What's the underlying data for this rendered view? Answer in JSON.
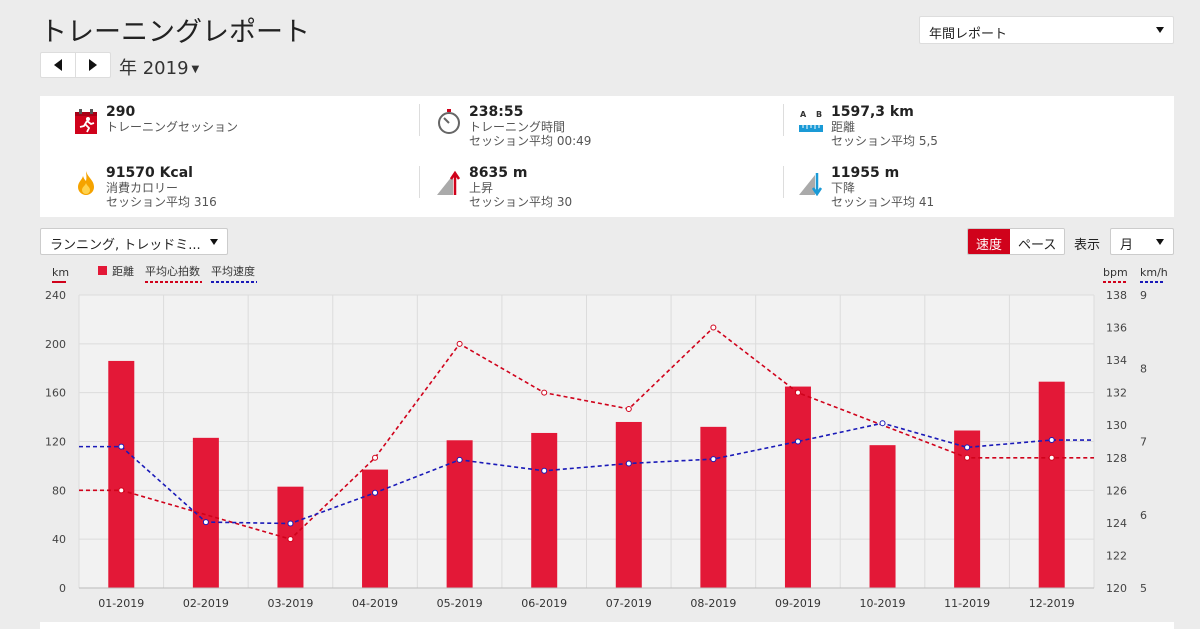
{
  "header": {
    "title": "トレーニングレポート",
    "period": "年 2019"
  },
  "report_select": {
    "value": "年間レポート"
  },
  "summary": [
    {
      "icon": "running-calendar-icon",
      "value": "290",
      "label": "トレーニングセッション",
      "sub": ""
    },
    {
      "icon": "stopwatch-icon",
      "value": "238:55",
      "label": "トレーニング時間",
      "sub": "セッション平均 00:49"
    },
    {
      "icon": "distance-ruler-icon",
      "value": "1597,3 km",
      "label": "距離",
      "sub": "セッション平均 5,5"
    },
    {
      "icon": "flame-icon",
      "value": "91570 Kcal",
      "label": "消費カロリー",
      "sub": "セッション平均 316"
    },
    {
      "icon": "ascent-icon",
      "value": "8635 m",
      "label": "上昇",
      "sub": "セッション平均 30"
    },
    {
      "icon": "descent-icon",
      "value": "11955 m",
      "label": "下降",
      "sub": "セッション平均 41"
    }
  ],
  "controls": {
    "sport": "ランニング, トレッドミ...",
    "speed_label": "速度",
    "pace_label": "ペース",
    "show_label": "表示",
    "group_by": "月"
  },
  "colors": {
    "accent": "#d0021b",
    "bar": "#e31837",
    "hr": "#d0021b",
    "speed": "#1a1ab8"
  },
  "chart_data": {
    "type": "bar",
    "categories": [
      "01-2019",
      "02-2019",
      "03-2019",
      "04-2019",
      "05-2019",
      "06-2019",
      "07-2019",
      "08-2019",
      "09-2019",
      "10-2019",
      "11-2019",
      "12-2019"
    ],
    "series": [
      {
        "name": "距離",
        "type": "bar",
        "axis": "km",
        "values": [
          186,
          123,
          83,
          97,
          121,
          127,
          136,
          132,
          165,
          117,
          129,
          169
        ]
      },
      {
        "name": "平均心拍数",
        "type": "line",
        "axis": "bpm",
        "values": [
          126,
          null,
          123,
          128,
          135,
          132,
          131,
          136,
          132,
          null,
          128,
          128
        ]
      },
      {
        "name": "平均速度",
        "type": "line",
        "axis": "km/h",
        "values": [
          6.93,
          5.9,
          5.88,
          6.3,
          6.75,
          6.6,
          6.7,
          6.76,
          7.0,
          7.25,
          6.92,
          7.02
        ]
      }
    ],
    "axes": {
      "left": {
        "unit": "km",
        "ticks": [
          0,
          40,
          80,
          120,
          160,
          200,
          240
        ],
        "range": [
          0,
          240
        ]
      },
      "bpm": {
        "unit": "bpm",
        "ticks": [
          120,
          122,
          124,
          126,
          128,
          130,
          132,
          134,
          136,
          138
        ],
        "range": [
          120,
          138
        ]
      },
      "speed": {
        "unit": "km/h",
        "ticks": [
          5,
          6,
          7,
          8,
          9
        ],
        "range": [
          5,
          9
        ]
      }
    },
    "legend": [
      "距離",
      "平均心拍数",
      "平均速度"
    ],
    "grid": true
  }
}
